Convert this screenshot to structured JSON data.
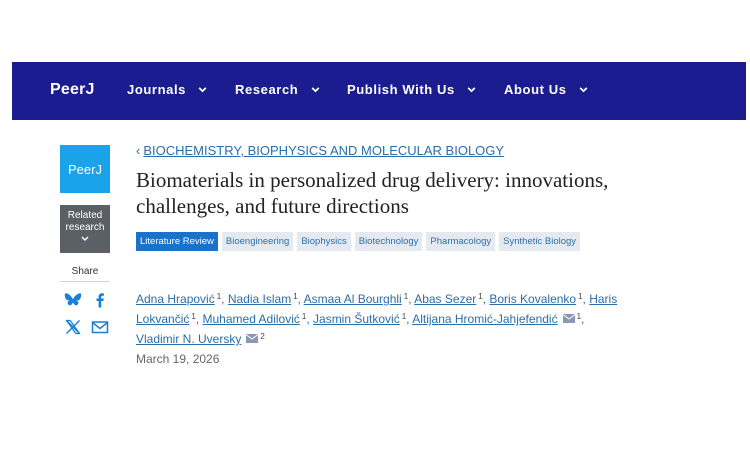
{
  "nav": {
    "logo": "PeerJ",
    "items": [
      {
        "label": "Journals"
      },
      {
        "label": "Research"
      },
      {
        "label": "Publish With Us"
      },
      {
        "label": "About Us"
      }
    ]
  },
  "rail": {
    "logo": "PeerJ",
    "related_line1": "Related",
    "related_line2": "research",
    "share_label": "Share",
    "icons": [
      "bluesky-icon",
      "facebook-icon",
      "x-icon",
      "email-icon"
    ]
  },
  "article": {
    "breadcrumb": "BIOCHEMISTRY, BIOPHYSICS AND MOLECULAR BIOLOGY",
    "title": "Biomaterials in personalized drug delivery: innovations, challenges, and future directions",
    "tags": [
      "Literature Review",
      "Bioengineering",
      "Biophysics",
      "Biotechnology",
      "Pharmacology",
      "Synthetic Biology"
    ],
    "authors": [
      {
        "name": "Adna Hrapović",
        "sup": "1"
      },
      {
        "name": "Nadia Islam",
        "sup": "1"
      },
      {
        "name": "Asmaa Al Bourghli",
        "sup": "1"
      },
      {
        "name": "Abas Sezer",
        "sup": "1"
      },
      {
        "name": "Boris Kovalenko",
        "sup": "1"
      },
      {
        "name": "Haris Lokvančić",
        "sup": "1"
      },
      {
        "name": "Muhamed Adilović",
        "sup": "1"
      },
      {
        "name": "Jasmin Šutković",
        "sup": "1"
      },
      {
        "name": "Altijana Hromić-Jahjefendić",
        "sup": "1"
      },
      {
        "name": "Vladimir N. Uversky",
        "sup": "2"
      }
    ],
    "date": "March 19, 2026"
  },
  "colors": {
    "navbar": "#1b1c8f",
    "peerj_blue": "#1aa3e8",
    "related_bg": "#5a6066",
    "link": "#2b6ea8",
    "tag_primary": "#1a73c8"
  }
}
